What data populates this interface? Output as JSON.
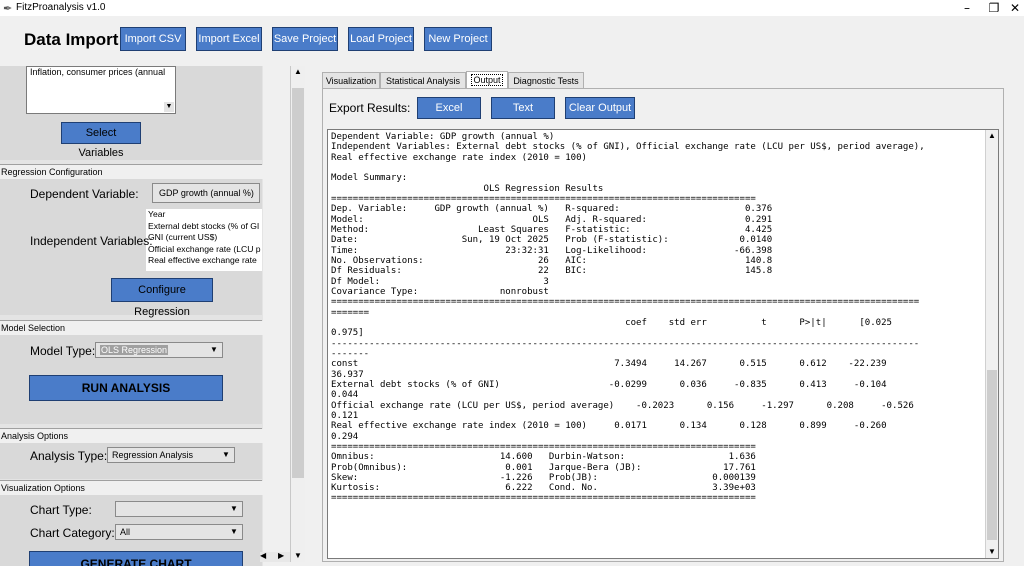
{
  "window": {
    "title": "FitzProanalysis v1.0"
  },
  "import_bar": {
    "label": "Data Import:",
    "buttons": [
      "Import CSV",
      "Import Excel",
      "Save Project",
      "Load Project",
      "New Project"
    ]
  },
  "variables_section": {
    "list_item": "Inflation, consumer prices (annual",
    "select_button": "Select Variables"
  },
  "regression_config": {
    "header": "Regression Configuration",
    "dependent_label": "Dependent Variable:",
    "dependent_value": "GDP growth (annual %)",
    "independent_label": "Independent Variables:",
    "independent_items": [
      "Year",
      "External debt stocks (% of GI",
      "GNI (current US$)",
      "Official exchange rate (LCU p",
      "Real effective exchange rate"
    ],
    "configure_button": "Configure Regression"
  },
  "model_selection": {
    "header": "Model Selection",
    "model_type_label": "Model Type:",
    "model_type_value": "OLS Regression",
    "run_button": "RUN ANALYSIS"
  },
  "analysis_options": {
    "header": "Analysis Options",
    "analysis_type_label": "Analysis Type:",
    "analysis_type_value": "Regression Analysis"
  },
  "visualization_options": {
    "header": "Visualization Options",
    "chart_type_label": "Chart Type:",
    "chart_type_value": "",
    "chart_category_label": "Chart Category:",
    "chart_category_value": "All",
    "generate_button": "GENERATE CHART"
  },
  "tabs": [
    {
      "label": "Visualization",
      "active": false
    },
    {
      "label": "Statistical Analysis",
      "active": false
    },
    {
      "label": "Output",
      "active": true
    },
    {
      "label": "Diagnostic Tests",
      "active": false
    }
  ],
  "export": {
    "label": "Export Results:",
    "buttons": [
      "Excel",
      "Text",
      "Clear Output"
    ]
  },
  "output_lines": [
    "Dependent Variable: GDP growth (annual %)",
    "Independent Variables: External debt stocks (% of GNI), Official exchange rate (LCU per US$, period average),",
    "Real effective exchange rate index (2010 = 100)",
    "",
    "Model Summary:",
    "                            OLS Regression Results",
    "==============================================================================",
    "Dep. Variable:     GDP growth (annual %)   R-squared:                       0.376",
    "Model:                               OLS   Adj. R-squared:                  0.291",
    "Method:                    Least Squares   F-statistic:                     4.425",
    "Date:                   Sun, 19 Oct 2025   Prob (F-statistic):             0.0140",
    "Time:                           23:32:31   Log-Likelihood:                -66.398",
    "No. Observations:                     26   AIC:                             140.8",
    "Df Residuals:                         22   BIC:                             145.8",
    "Df Model:                              3",
    "Covariance Type:               nonrobust",
    "============================================================================================================",
    "=======",
    "                                                      coef    std err          t      P>|t|      [0.025",
    "0.975]",
    "------------------------------------------------------------------------------------------------------------",
    "-------",
    "const                                               7.3494     14.267      0.515      0.612    -22.239",
    "36.937",
    "External debt stocks (% of GNI)                    -0.0299      0.036     -0.835      0.413     -0.104",
    "0.044",
    "Official exchange rate (LCU per US$, period average)    -0.2023      0.156     -1.297      0.208     -0.526",
    "0.121",
    "Real effective exchange rate index (2010 = 100)     0.0171      0.134      0.128      0.899     -0.260",
    "0.294",
    "==============================================================================",
    "Omnibus:                       14.600   Durbin-Watson:                   1.636",
    "Prob(Omnibus):                  0.001   Jarque-Bera (JB):               17.761",
    "Skew:                          -1.226   Prob(JB):                     0.000139",
    "Kurtosis:                       6.222   Cond. No.                     3.39e+03",
    "=============================================================================="
  ]
}
